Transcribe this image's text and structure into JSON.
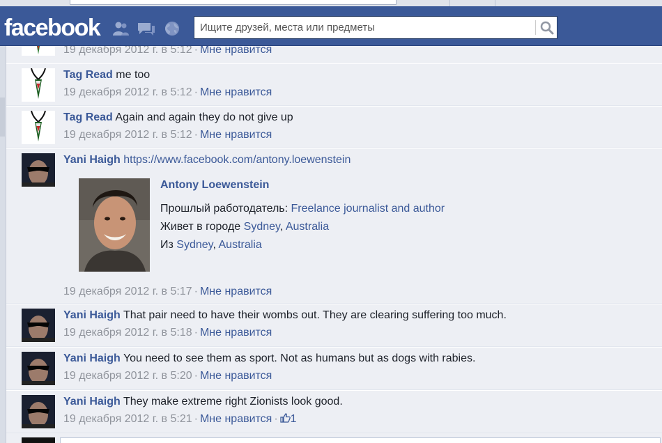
{
  "header": {
    "logo": "facebook",
    "search_placeholder": "Ищите друзей, места или предметы"
  },
  "comments": [
    {
      "author": "",
      "text": "",
      "time": "19 декабря 2012 г. в 5:12",
      "like_label": "Мне нравится"
    },
    {
      "author": "Tag Read",
      "text": "me too",
      "time": "19 декабря 2012 г. в 5:12",
      "like_label": "Мне нравится"
    },
    {
      "author": "Tag Read",
      "text": "Again and again they do not give up",
      "time": "19 декабря 2012 г. в 5:12",
      "like_label": "Мне нравится"
    },
    {
      "author": "Yani Haigh",
      "text": "https://www.facebook.com/antony.loewenstein",
      "time": "19 декабря 2012 г. в 5:17",
      "like_label": "Мне нравится"
    },
    {
      "author": "Yani Haigh",
      "text": "That pair need to have their wombs out. They are clearing suffering too much.",
      "time": "19 декабря 2012 г. в 5:18",
      "like_label": "Мне нравится"
    },
    {
      "author": "Yani Haigh",
      "text": "You need to see them as sport. Not as humans but as dogs with rabies.",
      "time": "19 декабря 2012 г. в 5:20",
      "like_label": "Мне нравится"
    },
    {
      "author": "Yani Haigh",
      "text": "They make extreme right Zionists look good.",
      "time": "19 декабря 2012 г. в 5:21",
      "like_label": "Мне нравится",
      "like_count": "1"
    }
  ],
  "link_preview": {
    "name": "Antony Loewenstein",
    "employer_label": "Прошлый работодатель:",
    "employer": "Freelance journalist and author",
    "lives_label": "Живет в городе",
    "lives_city": "Sydney",
    "lives_country": "Australia",
    "from_label": "Из",
    "from_city": "Sydney",
    "from_country": "Australia",
    "separator": ", "
  },
  "icons": {
    "friends": "friend-requests-icon",
    "messages": "messages-icon",
    "notifications": "notifications-globe-icon",
    "search": "magnifier-icon",
    "like": "thumbs-up-icon"
  },
  "colors": {
    "brand_blue": "#3b5998",
    "background": "#edeff4",
    "meta_gray": "#90949c",
    "text": "#1d2129"
  }
}
